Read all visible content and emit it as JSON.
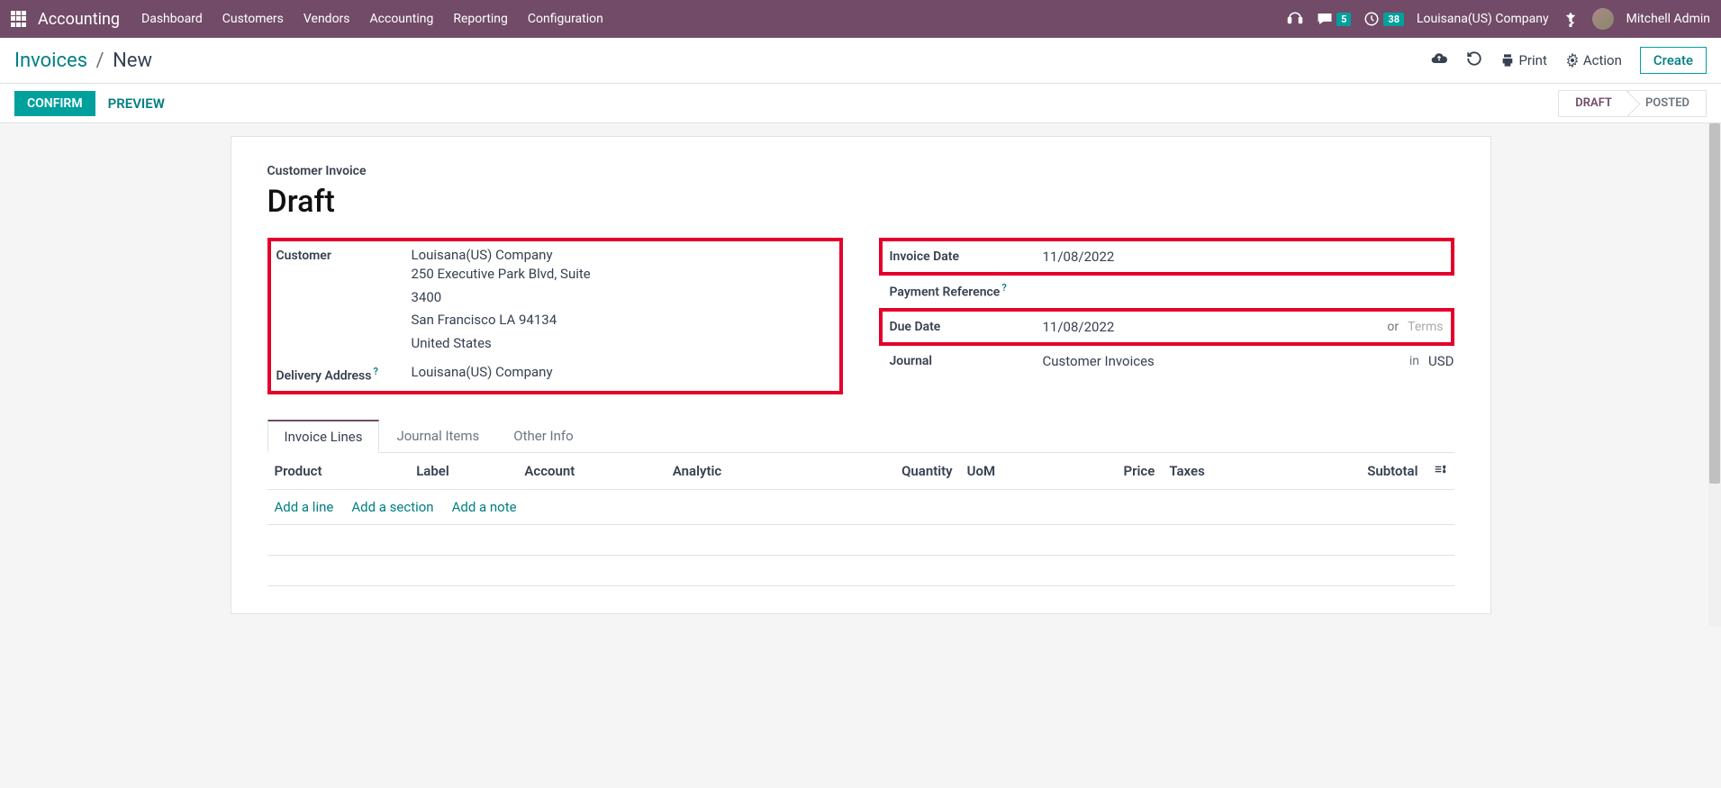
{
  "navbar": {
    "brand": "Accounting",
    "menu": [
      "Dashboard",
      "Customers",
      "Vendors",
      "Accounting",
      "Reporting",
      "Configuration"
    ],
    "chat_badge": "5",
    "activity_badge": "38",
    "company": "Louisana(US) Company",
    "user": "Mitchell Admin"
  },
  "breadcrumb": {
    "parent": "Invoices",
    "current": "New"
  },
  "cp": {
    "print": "Print",
    "action": "Action",
    "create": "Create"
  },
  "statusbar": {
    "confirm": "CONFIRM",
    "preview": "PREVIEW",
    "steps": [
      "DRAFT",
      "POSTED"
    ]
  },
  "form": {
    "subtitle": "Customer Invoice",
    "title": "Draft",
    "customer_label": "Customer",
    "customer_name": "Louisana(US) Company",
    "addr1": "250 Executive Park Blvd, Suite",
    "addr2": "3400",
    "addr3": "San Francisco LA 94134",
    "addr4": "United States",
    "delivery_label": "Delivery Address",
    "delivery_value": "Louisana(US) Company",
    "invoice_date_label": "Invoice Date",
    "invoice_date_value": "11/08/2022",
    "payment_ref_label": "Payment Reference",
    "due_date_label": "Due Date",
    "due_date_value": "11/08/2022",
    "or": "or",
    "terms": "Terms",
    "journal_label": "Journal",
    "journal_value": "Customer Invoices",
    "in": "in",
    "currency": "USD"
  },
  "tabs": [
    "Invoice Lines",
    "Journal Items",
    "Other Info"
  ],
  "table": {
    "headers": {
      "product": "Product",
      "label": "Label",
      "account": "Account",
      "analytic": "Analytic",
      "quantity": "Quantity",
      "uom": "UoM",
      "price": "Price",
      "taxes": "Taxes",
      "subtotal": "Subtotal"
    },
    "add_line": "Add a line",
    "add_section": "Add a section",
    "add_note": "Add a note"
  }
}
